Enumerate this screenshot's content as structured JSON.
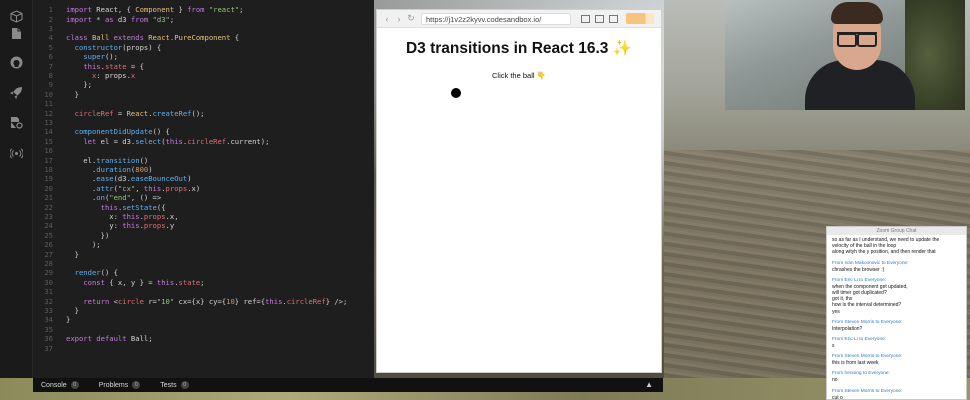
{
  "editor": {
    "lines": [
      {
        "n": "1",
        "html": "<span class=\"kw\">import</span> React, { <span class=\"cls\">Component</span> } <span class=\"kw\">from</span> <span class=\"str\">\"react\"</span>;"
      },
      {
        "n": "2",
        "html": "<span class=\"kw\">import</span> * <span class=\"kw\">as</span> d3 <span class=\"kw\">from</span> <span class=\"str\">\"d3\"</span>;"
      },
      {
        "n": "3",
        "html": ""
      },
      {
        "n": "4",
        "html": "<span class=\"kw\">class</span> <span class=\"cls\">Ball</span> <span class=\"kw\">extends</span> <span class=\"cls\">React</span>.<span class=\"cls\">PureComponent</span> {"
      },
      {
        "n": "5",
        "html": "  <span class=\"fn\">constructor</span>(props) {"
      },
      {
        "n": "6",
        "html": "    <span class=\"fn\">super</span>();"
      },
      {
        "n": "7",
        "html": "    <span class=\"kw\">this</span>.<span class=\"prop\">state</span> = {"
      },
      {
        "n": "8",
        "html": "      <span class=\"prop\">x</span>: props.<span class=\"prop\">x</span>"
      },
      {
        "n": "9",
        "html": "    };"
      },
      {
        "n": "10",
        "html": "  }"
      },
      {
        "n": "11",
        "html": ""
      },
      {
        "n": "12",
        "html": "  <span class=\"prop\">circleRef</span> = <span class=\"cls\">React</span>.<span class=\"fn\">createRef</span>();"
      },
      {
        "n": "13",
        "html": ""
      },
      {
        "n": "14",
        "html": "  <span class=\"fn\">componentDidUpdate</span>() {"
      },
      {
        "n": "15",
        "html": "    <span class=\"kw\">let</span> el = d3.<span class=\"fn\">select</span>(<span class=\"kw\">this</span>.<span class=\"prop\">circleRef</span>.current);"
      },
      {
        "n": "16",
        "html": ""
      },
      {
        "n": "17",
        "html": "    el.<span class=\"fn\">transition</span>()"
      },
      {
        "n": "18",
        "html": "      .<span class=\"fn\">duration</span>(<span class=\"num\">800</span>)"
      },
      {
        "n": "19",
        "html": "      .<span class=\"fn\">ease</span>(d3.<span class=\"fn\">easeBounceOut</span>)"
      },
      {
        "n": "20",
        "html": "      .<span class=\"fn\">attr</span>(<span class=\"str\">\"cx\"</span>, <span class=\"kw\">this</span>.<span class=\"prop\">props</span>.x)"
      },
      {
        "n": "21",
        "html": "      .<span class=\"fn\">on</span>(<span class=\"str\">\"end\"</span>, () =>"
      },
      {
        "n": "22",
        "html": "        <span class=\"kw\">this</span>.<span class=\"fn\">setState</span>({"
      },
      {
        "n": "23",
        "html": "          x: <span class=\"kw\">this</span>.<span class=\"prop\">props</span>.x,"
      },
      {
        "n": "24",
        "html": "          y: <span class=\"kw\">this</span>.<span class=\"prop\">props</span>.y"
      },
      {
        "n": "25",
        "html": "        })"
      },
      {
        "n": "26",
        "html": "      );"
      },
      {
        "n": "27",
        "html": "  }"
      },
      {
        "n": "28",
        "html": ""
      },
      {
        "n": "29",
        "html": "  <span class=\"fn\">render</span>() {"
      },
      {
        "n": "30",
        "html": "    <span class=\"kw\">const</span> { x, y } = <span class=\"kw\">this</span>.<span class=\"prop\">state</span>;"
      },
      {
        "n": "31",
        "html": ""
      },
      {
        "n": "32",
        "html": "    <span class=\"kw\">return</span> &lt;<span class=\"prop\">circle</span> r=<span class=\"str\">\"10\"</span> cx={x} cy={<span class=\"num\">10</span>} ref={<span class=\"kw\">this</span>.<span class=\"prop\">circleRef</span>} /&gt;;"
      },
      {
        "n": "33",
        "html": "  }"
      },
      {
        "n": "34",
        "html": "}"
      },
      {
        "n": "35",
        "html": ""
      },
      {
        "n": "36",
        "html": "<span class=\"kw\">export</span> <span class=\"kw\">default</span> Ball;"
      },
      {
        "n": "37",
        "html": ""
      }
    ]
  },
  "bottom_tabs": [
    {
      "label": "Console",
      "count": "0"
    },
    {
      "label": "Problems",
      "count": "0"
    },
    {
      "label": "Tests",
      "count": "0"
    }
  ],
  "browser": {
    "url": "https://j1v2z2kyvv.codesandbox.io/",
    "title": "D3 transitions in React 16.3 ✨",
    "hint": "Click the ball 👇"
  },
  "chat": {
    "window_title": "Zoom Group Chat",
    "messages": [
      {
        "from": "",
        "lines": [
          "so as far as I understand, we need to update the",
          "velocity of the ball in the loop",
          "along wityh the y position, and then render that"
        ]
      },
      {
        "from": "From Ivan Makoimovic to Everyone:",
        "lines": [
          "chrashes the browser :)"
        ]
      },
      {
        "from": "From Eric Li to Everyone:",
        "lines": [
          "when the component get updated,",
          "will timer got duplicated?",
          "got it, thx",
          "how is the interval determined?",
          "yes"
        ]
      },
      {
        "from": "From Steven Morris to Everyone:",
        "lines": [
          "Interpolation?"
        ]
      },
      {
        "from": "From Eric Li to Everyone:",
        "lines": [
          "s"
        ]
      },
      {
        "from": "From Steven Morris to Everyone:",
        "lines": [
          "this is from last week"
        ]
      },
      {
        "from": "From henning to Everyone:",
        "lines": [
          "no"
        ]
      },
      {
        "from": "From Steven Morris to Everyone:",
        "lines": [
          "cut o"
        ]
      }
    ]
  },
  "colors": {
    "editor_bg": "#1e1e1e",
    "keyword": "#c678dd",
    "string": "#98c379",
    "function": "#61afef",
    "property": "#e06c75",
    "number": "#d19a66",
    "class": "#e5c07b",
    "chat_link": "#2d79c7"
  },
  "icons": {
    "rail": [
      "cube-icon",
      "file-icon",
      "github-icon",
      "rocket-icon",
      "file-settings-icon",
      "broadcast-icon"
    ],
    "browser_nav": [
      "back-arrow-icon",
      "forward-arrow-icon",
      "reload-icon"
    ]
  }
}
